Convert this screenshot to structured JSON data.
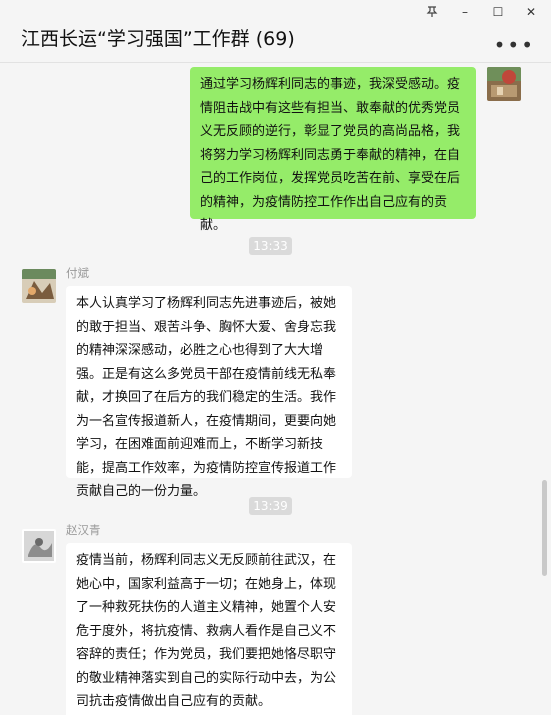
{
  "window": {
    "title": "江西长运“学习强国”工作群 (69)",
    "pin_icon": "pin-icon",
    "minimize_glyph": "–",
    "maximize_glyph": "☐",
    "close_glyph": "✕",
    "more_glyph": "•••"
  },
  "messages": [
    {
      "type": "me",
      "text": "通过学习杨辉利同志的事迹，我深受感动。疫情阻击战中有这些有担当、敢奉献的优秀党员义无反顾的逆行，彰显了党员的高尚品格，我将努力学习杨辉利同志勇于奉献的精神，在自己的工作岗位，发挥党员吃苦在前、享受在后的精神，为疫情防控工作作出自己应有的贡献。"
    },
    {
      "type": "time",
      "text": "13:33"
    },
    {
      "type": "other",
      "sender": "付斌",
      "text": "本人认真学习了杨辉利同志先进事迹后，被她的敢于担当、艰苦斗争、胸怀大爱、舍身忘我的精神深深感动，必胜之心也得到了大大增强。正是有这么多党员干部在疫情前线无私奉献，才换回了在后方的我们稳定的生活。我作为一名宣传报道新人，在疫情期间，更要向她学习，在困难面前迎难而上，不断学习新技能，提高工作效率，为疫情防控宣传报道工作贡献自己的一份力量。"
    },
    {
      "type": "time",
      "text": "13:39"
    },
    {
      "type": "other",
      "sender": "赵汉青",
      "text": " 疫情当前，杨辉利同志义无反顾前往武汉，在她心中，国家利益高于一切；在她身上，体现了一种救死扶伤的人道主义精神，她置个人安危于度外，将抗疫情、救病人看作是自己义不容辞的责任；作为党员，我们要把她恪尽职守的敬业精神落实到自己的实际行动中去，为公司抗击疫情做出自己应有的贡献。"
    }
  ],
  "colors": {
    "my_bubble": "#95ec69",
    "other_bubble": "#ffffff",
    "background": "#f5f5f5"
  }
}
